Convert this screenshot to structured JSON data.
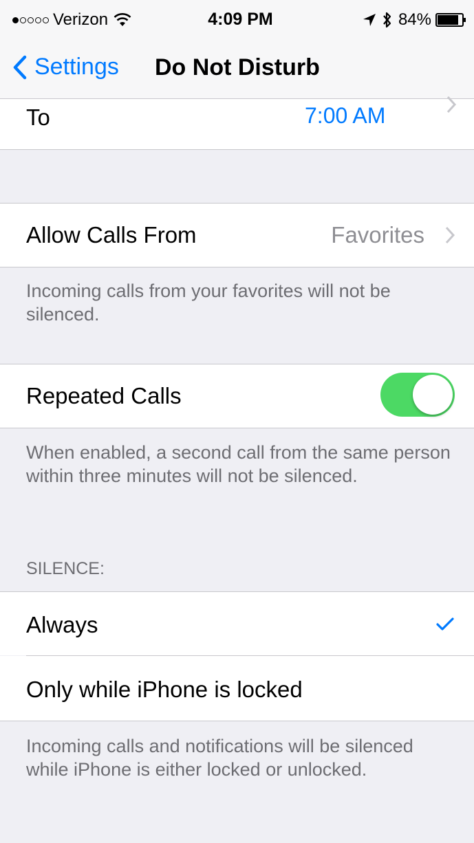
{
  "status_bar": {
    "carrier": "Verizon",
    "time": "4:09 PM",
    "battery_percent": "84%",
    "signal_bars_filled": 1,
    "signal_bars_total": 5,
    "icons": [
      "wifi-icon",
      "location-icon",
      "bluetooth-icon",
      "battery-icon"
    ]
  },
  "nav": {
    "back_label": "Settings",
    "title": "Do Not Disturb"
  },
  "scheduled": {
    "to_label": "To",
    "to_value": "7:00 AM"
  },
  "allow_calls": {
    "label": "Allow Calls From",
    "value": "Favorites",
    "footer": "Incoming calls from your favorites will not be silenced."
  },
  "repeated_calls": {
    "label": "Repeated Calls",
    "enabled": true,
    "footer": "When enabled, a second call from the same person within three minutes will not be silenced."
  },
  "silence": {
    "header": "SILENCE:",
    "options": [
      {
        "label": "Always",
        "selected": true
      },
      {
        "label": "Only while iPhone is locked",
        "selected": false
      }
    ],
    "footer": "Incoming calls and notifications will be silenced while iPhone is either locked or unlocked."
  },
  "colors": {
    "accent": "#007aff",
    "toggle_on": "#4cd964",
    "background": "#efeff4",
    "secondary_text": "#6d6d72",
    "value_gray": "#8e8e93"
  }
}
